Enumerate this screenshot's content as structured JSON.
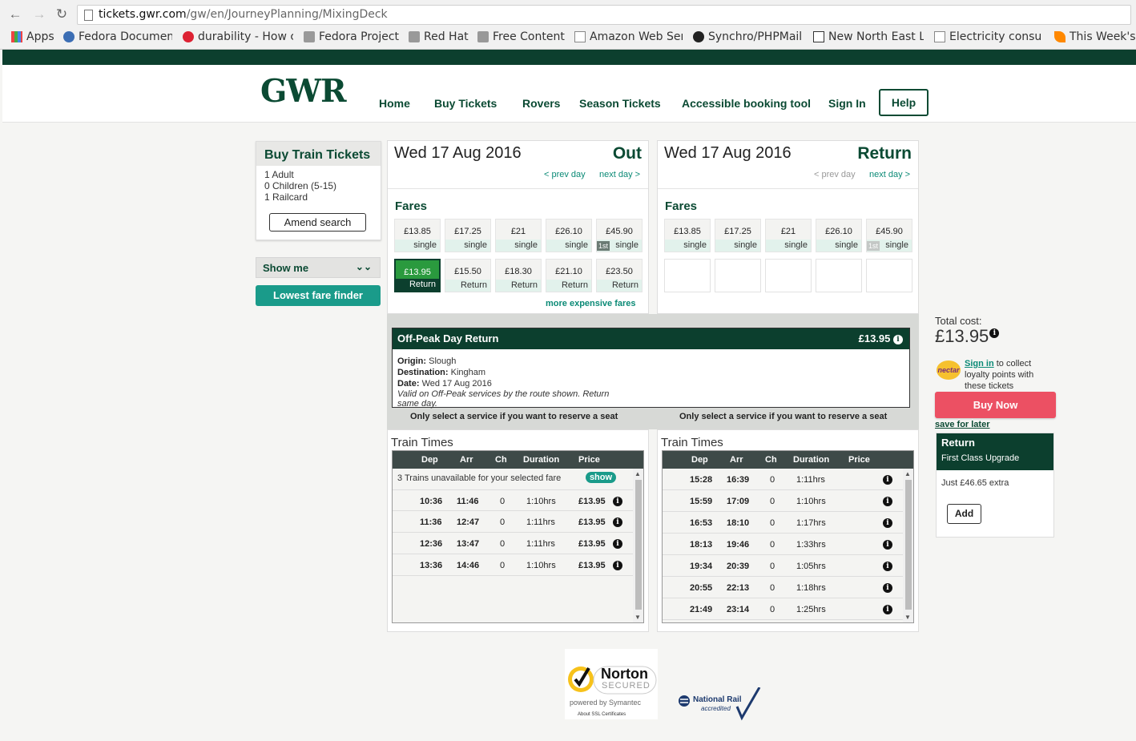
{
  "browser": {
    "url_domain": "tickets.gwr.com",
    "url_path": "/gw/en/JourneyPlanning/MixingDeck",
    "bookmarks": [
      "Apps",
      "Fedora Documen",
      "durability - How c",
      "Fedora Project",
      "Red Hat",
      "Free Content",
      "Amazon Web Ser",
      "Synchro/PHPMail",
      "New North East L",
      "Electricity consu",
      "This Week's"
    ]
  },
  "header": {
    "logo": "GWR",
    "nav": [
      "Home",
      "Buy Tickets",
      "Rovers",
      "Season Tickets",
      "Accessible booking tool",
      "Sign In"
    ],
    "help": "Help"
  },
  "sidebar": {
    "title": "Buy Train Tickets",
    "passengers": [
      "1 Adult",
      "0 Children (5-15)",
      "1 Railcard"
    ],
    "amend": "Amend search",
    "show_me": "Show me",
    "lowest_fare": "Lowest fare finder"
  },
  "out": {
    "date": "Wed 17 Aug 2016",
    "dir": "Out",
    "prev": "< prev day",
    "next": "next day >",
    "fares_title": "Fares",
    "singles": [
      {
        "price": "£13.85",
        "label": "single",
        "first": false
      },
      {
        "price": "£17.25",
        "label": "single",
        "first": false
      },
      {
        "price": "£21",
        "label": "single",
        "first": false
      },
      {
        "price": "£26.10",
        "label": "single",
        "first": false
      },
      {
        "price": "£45.90",
        "label": "single",
        "first": true
      }
    ],
    "returns": [
      {
        "price": "£13.95",
        "label": "Return"
      },
      {
        "price": "£15.50",
        "label": "Return"
      },
      {
        "price": "£18.30",
        "label": "Return"
      },
      {
        "price": "£21.10",
        "label": "Return"
      },
      {
        "price": "£23.50",
        "label": "Return"
      }
    ],
    "more": "more expensive fares",
    "first_badge": "1st"
  },
  "ret": {
    "date": "Wed 17 Aug 2016",
    "dir": "Return",
    "prev": "< prev day",
    "next": "next day >",
    "fares_title": "Fares",
    "singles": [
      {
        "price": "£13.85",
        "label": "single"
      },
      {
        "price": "£17.25",
        "label": "single"
      },
      {
        "price": "£21",
        "label": "single"
      },
      {
        "price": "£26.10",
        "label": "single"
      },
      {
        "price": "£45.90",
        "label": "single"
      }
    ]
  },
  "fare_detail": {
    "name": "Off-Peak Day Return",
    "price": "£13.95",
    "origin_label": "Origin:",
    "origin": "Slough",
    "dest_label": "Destination:",
    "dest": "Kingham",
    "date_label": "Date:",
    "date": "Wed 17 Aug 2016",
    "valid": "Valid on Off-Peak services by the route shown. Return same day."
  },
  "seat_note": "Only select a service if you want to reserve a seat",
  "train_times": {
    "title": "Train Times",
    "headers": [
      "Dep",
      "Arr",
      "Ch",
      "Duration",
      "Price"
    ],
    "unavailable": "3 Trains unavailable for your selected fare",
    "show": "show",
    "out_rows": [
      {
        "dep": "10:36",
        "arr": "11:46",
        "ch": "0",
        "dur": "1:10hrs",
        "price": "£13.95"
      },
      {
        "dep": "11:36",
        "arr": "12:47",
        "ch": "0",
        "dur": "1:11hrs",
        "price": "£13.95"
      },
      {
        "dep": "12:36",
        "arr": "13:47",
        "ch": "0",
        "dur": "1:11hrs",
        "price": "£13.95"
      },
      {
        "dep": "13:36",
        "arr": "14:46",
        "ch": "0",
        "dur": "1:10hrs",
        "price": "£13.95"
      }
    ],
    "ret_rows": [
      {
        "dep": "15:28",
        "arr": "16:39",
        "ch": "0",
        "dur": "1:11hrs"
      },
      {
        "dep": "15:59",
        "arr": "17:09",
        "ch": "0",
        "dur": "1:10hrs"
      },
      {
        "dep": "16:53",
        "arr": "18:10",
        "ch": "0",
        "dur": "1:17hrs"
      },
      {
        "dep": "18:13",
        "arr": "19:46",
        "ch": "0",
        "dur": "1:33hrs"
      },
      {
        "dep": "19:34",
        "arr": "20:39",
        "ch": "0",
        "dur": "1:05hrs"
      },
      {
        "dep": "20:55",
        "arr": "22:13",
        "ch": "0",
        "dur": "1:18hrs"
      },
      {
        "dep": "21:49",
        "arr": "23:14",
        "ch": "0",
        "dur": "1:25hrs"
      }
    ]
  },
  "summary": {
    "total_label": "Total cost:",
    "total": "£13.95",
    "nectar": "nectar",
    "sign_in": "Sign in",
    "collect": " to collect loyalty points with these tickets",
    "buy_now": "Buy Now",
    "save_later": "save for later",
    "upgrade_title": "Return",
    "upgrade_sub": "First Class Upgrade",
    "upgrade_price": "Just £46.65 extra",
    "add": "Add"
  },
  "footer": {
    "norton": "Norton",
    "norton_secured": "SECURED",
    "norton_powered": "powered by Symantec",
    "norton_about": "About SSL Certificates",
    "rail": "National Rail",
    "rail_acc": "accredited"
  },
  "colors": {
    "brand": "#0b4a33",
    "teal": "#1a9b8a",
    "buy": "#ec5063",
    "selected": "#2a9a3e"
  }
}
